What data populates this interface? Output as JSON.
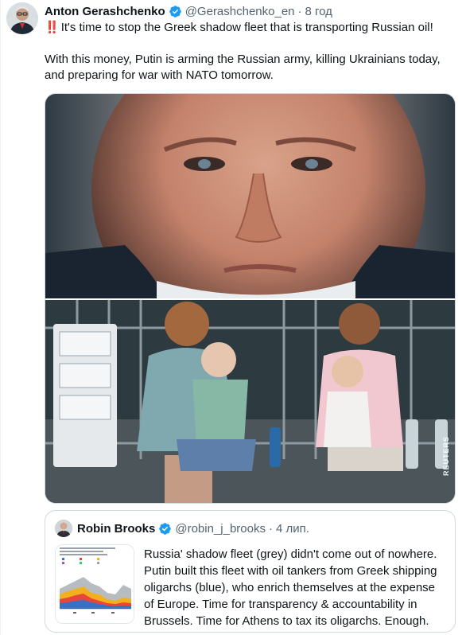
{
  "tweet": {
    "author": {
      "display_name": "Anton Gerashchenko",
      "handle": "@Gerashchenko_en",
      "verified": true,
      "avatar_icon": "author-avatar"
    },
    "time": "8 год",
    "separator": "·",
    "lead_emoji": "‼️",
    "text_line1": "It's time to stop the Greek shadow fleet that is transporting Russian oil!",
    "text_paragraph2": "With this money, Putin is arming the Russian army, killing Ukrainians today, and preparing for war with NATO tomorrow.",
    "media": {
      "watermark": "REUTERS"
    }
  },
  "quoted_tweet": {
    "author": {
      "display_name": "Robin Brooks",
      "handle": "@robin_j_brooks",
      "verified": true
    },
    "time": "4 лип.",
    "separator": "·",
    "text": "Russia' shadow fleet (grey) didn't come out of nowhere. Putin built this fleet with oil tankers from Greek shipping oligarchs (blue), who enrich themselves at the expense of Europe. Time for transparency & accountability in Brussels. Time for Athens to tax its oligarchs. Enough."
  },
  "colors": {
    "verified_blue": "#1d9bf0",
    "secondary_text": "#536471",
    "primary_text": "#0f1419",
    "border": "#cfd9de"
  }
}
